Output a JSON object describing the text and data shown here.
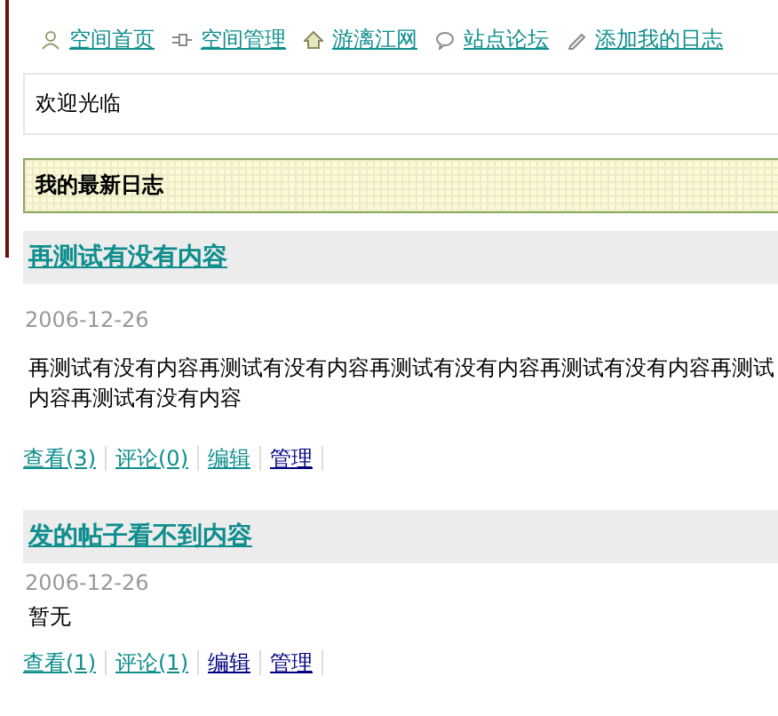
{
  "nav": [
    {
      "label": "空间首页"
    },
    {
      "label": "空间管理"
    },
    {
      "label": "游漓江网"
    },
    {
      "label": "站点论坛"
    },
    {
      "label": "添加我的日志"
    }
  ],
  "welcome": "欢迎光临",
  "section_title": "我的最新日志",
  "posts": [
    {
      "title": "再测试有没有内容",
      "date": "2006-12-26",
      "body_lines": [
        "再测试有没有内容再测试有没有内容再测试有没有内容再测试有没有内容再测试",
        "内容再测试有没有内容"
      ],
      "actions": [
        {
          "label": "查看(3)",
          "visited": false
        },
        {
          "label": "评论(0)",
          "visited": false
        },
        {
          "label": "编辑",
          "visited": false
        },
        {
          "label": "管理",
          "visited": true
        }
      ]
    },
    {
      "title": "发的帖子看不到内容",
      "date": "2006-12-26",
      "body_lines": [
        "暂无"
      ],
      "actions": [
        {
          "label": "查看(1)",
          "visited": false
        },
        {
          "label": "评论(1)",
          "visited": false
        },
        {
          "label": "编辑",
          "visited": true
        },
        {
          "label": "管理",
          "visited": true
        }
      ]
    }
  ]
}
